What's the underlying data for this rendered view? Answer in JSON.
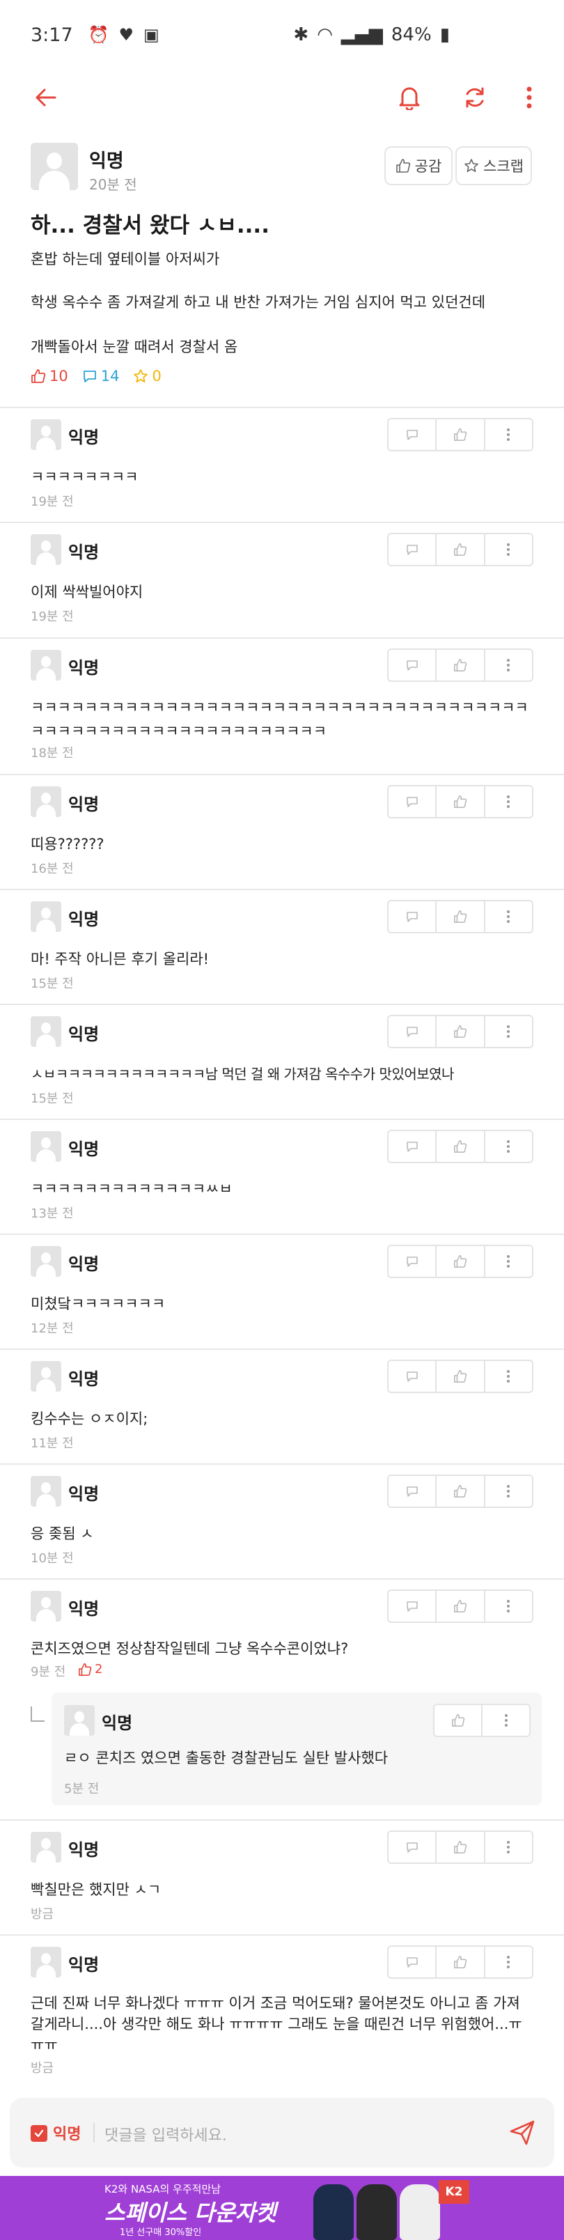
{
  "status_bar": {
    "time": "3:17",
    "battery": "84%"
  },
  "post": {
    "author": "익명",
    "time": "20분 전",
    "empathy_label": "공감",
    "scrap_label": "스크랩",
    "title": "하... 경찰서 왔다 ㅅㅂ....",
    "lines": [
      "혼밥 하는데 옆테이블 아저씨가",
      "학생 옥수수 좀 가져갈게 하고 내 반찬 가져가는 거임 심지어 먹고 있던건데",
      "개빡돌아서 눈깔 때려서 경찰서 옴"
    ],
    "likes": "10",
    "comments": "14",
    "scraps": "0"
  },
  "comments": [
    {
      "author": "익명",
      "text": "ㅋㅋㅋㅋㅋㅋㅋㅋ",
      "time": "19분 전"
    },
    {
      "author": "익명",
      "text": "이제 싹싹빌어야지",
      "time": "19분 전"
    },
    {
      "author": "익명",
      "text": "ㅋㅋㅋㅋㅋㅋㅋㅋㅋㅋㅋㅋㅋㅋㅋㅋㅋㅋㅋㅋㅋㅋㅋㅋㅋㅋㅋㅋㅋㅋㅋㅋㅋㅋㅋㅋㅋㅋㅋㅋㅋㅋㅋㅋㅋㅋㅋㅋㅋㅋㅋㅋㅋㅋㅋㅋㅋㅋㅋ",
      "time": "18분 전"
    },
    {
      "author": "익명",
      "text": "띠용??????",
      "time": "16분 전"
    },
    {
      "author": "익명",
      "text": "마! 주작 아니믄 후기 올리라!",
      "time": "15분 전"
    },
    {
      "author": "익명",
      "text": "ㅅㅂㅋㅋㅋㅋㅋㅋㅋㅋㅋㅋㅋㅋ남 먹던 걸 왜 가져감 옥수수가 맛있어보였나",
      "time": "15분 전"
    },
    {
      "author": "익명",
      "text": "ㅋㅋㅋㅋㅋㅋㅋㅋㅋㅋㅋㅋㅋㅆㅂ",
      "time": "13분 전"
    },
    {
      "author": "익명",
      "text": "미쳤닼ㅋㅋㅋㅋㅋㅋㅋ",
      "time": "12분 전"
    },
    {
      "author": "익명",
      "text": "킹수수는 ㅇㅈ이지;",
      "time": "11분 전"
    },
    {
      "author": "익명",
      "text": "응 좆됨 ㅅ",
      "time": "10분 전"
    },
    {
      "author": "익명",
      "text": "콘치즈였으면 정상참작일텐데 그냥 옥수수콘이었냐?",
      "time": "9분 전",
      "likes": "2"
    },
    {
      "author": "익명",
      "text": "빡칠만은 했지만 ㅅㄱ",
      "time": "방금"
    },
    {
      "author": "익명",
      "text": "근데 진짜 너무 화나겠다 ㅠㅠㅠ 이거 조금 먹어도돼? 물어본것도 아니고 좀 가져갈게라니....아 생각만 해도 화나 ㅠㅠㅠㅠ 그래도 눈을 때린건 너무 위험했어...ㅠㅠㅠ",
      "time": "방금"
    }
  ],
  "reply": {
    "author": "익명",
    "text": "ㄹㅇ 콘치즈 였으면 출동한 경찰관님도 실탄 발사했다",
    "time": "5분 전"
  },
  "input": {
    "anon_label": "익명",
    "placeholder": "댓글을 입력하세요."
  },
  "ad": {
    "line1": "K2와 NASA의 우주적만남",
    "headline": "스페이스 다운자켓",
    "line3": "1년 선구매 30%할인",
    "brand": "K2"
  },
  "colors": {
    "accent": "#e5453a",
    "like": "#e5453a",
    "comment": "#2aa3d8",
    "scrap": "#f2b70a",
    "ad_bg": "#a03fd6"
  }
}
